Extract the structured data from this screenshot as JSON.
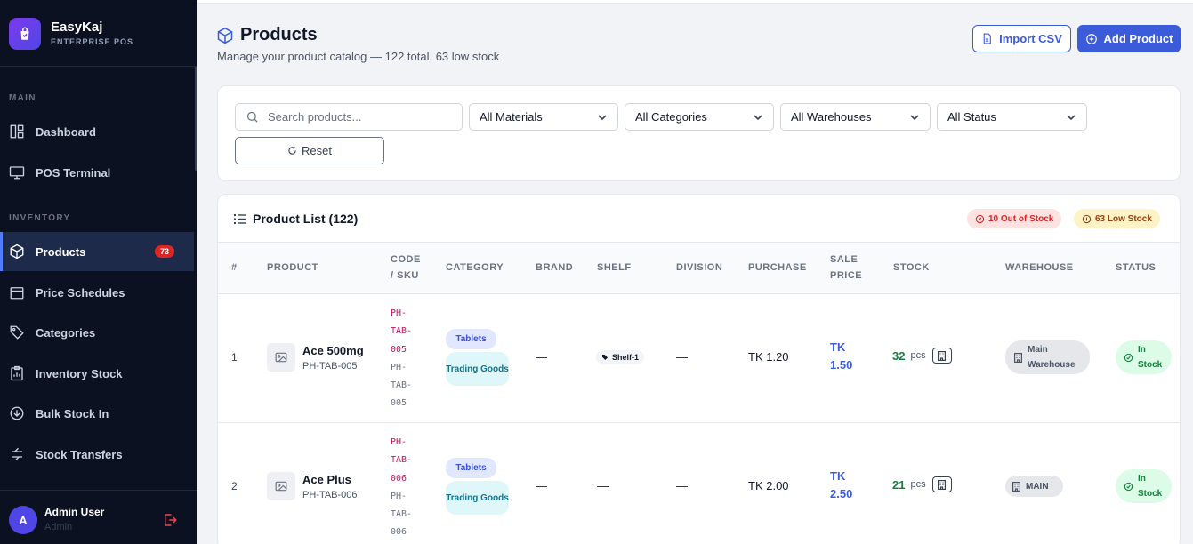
{
  "brand": {
    "name": "EasyKaj",
    "subtitle": "ENTERPRISE POS"
  },
  "sidebar": {
    "sections": [
      {
        "label": "MAIN"
      },
      {
        "label": "INVENTORY"
      }
    ],
    "items": [
      {
        "label": "Dashboard",
        "icon": "dashboard-icon"
      },
      {
        "label": "POS Terminal",
        "icon": "monitor-icon"
      },
      {
        "label": "Products",
        "icon": "box-icon",
        "badge": "73",
        "active": true
      },
      {
        "label": "Price Schedules",
        "icon": "calendar-icon"
      },
      {
        "label": "Categories",
        "icon": "tag-icon"
      },
      {
        "label": "Inventory Stock",
        "icon": "clipboard-icon"
      },
      {
        "label": "Bulk Stock In",
        "icon": "download-circle-icon"
      },
      {
        "label": "Stock Transfers",
        "icon": "transfer-icon"
      }
    ]
  },
  "user": {
    "initial": "A",
    "name": "Admin User",
    "role": "Admin"
  },
  "page": {
    "title": "Products",
    "subtitle": "Manage your product catalog — 122 total, 63 low stock"
  },
  "actions": {
    "import_label": "Import CSV",
    "add_label": "Add Product"
  },
  "filters": {
    "search_placeholder": "Search products...",
    "materials": "All Materials",
    "categories": "All Categories",
    "warehouses": "All Warehouses",
    "status": "All Status",
    "reset_label": "Reset"
  },
  "list": {
    "title": "Product List (122)",
    "out_of_stock": "10 Out of Stock",
    "low_stock": "63 Low Stock"
  },
  "columns": {
    "num": "#",
    "product": "PRODUCT",
    "code_1": "CODE",
    "code_2": "/ SKU",
    "category": "CATEGORY",
    "brand": "BRAND",
    "shelf": "SHELF",
    "division": "DIVISION",
    "purchase": "PURCHASE",
    "sale_1": "SALE",
    "sale_2": "PRICE",
    "stock": "STOCK",
    "warehouse": "WAREHOUSE",
    "status": "STATUS"
  },
  "rows": [
    {
      "num": "1",
      "name": "Ace 500mg",
      "sku": "PH-TAB-005",
      "code_lines": [
        "PH-",
        "TAB-",
        "005"
      ],
      "sku_lines": [
        "PH-",
        "TAB-",
        "005"
      ],
      "category": "Tablets",
      "type": "Trading Goods",
      "brand": "—",
      "shelf": "Shelf-1",
      "division": "—",
      "purchase": "TK 1.20",
      "sale_cur": "TK",
      "sale_val": "1.50",
      "stock": "32",
      "unit": "pcs",
      "warehouse_1": "Main",
      "warehouse_2": "Warehouse",
      "status_1": "In",
      "status_2": "Stock"
    },
    {
      "num": "2",
      "name": "Ace Plus",
      "sku": "PH-TAB-006",
      "code_lines": [
        "PH-",
        "TAB-",
        "006"
      ],
      "sku_lines": [
        "PH-",
        "TAB-",
        "006"
      ],
      "category": "Tablets",
      "type": "Trading Goods",
      "brand": "—",
      "shelf": "—",
      "division": "—",
      "purchase": "TK 2.00",
      "sale_cur": "TK",
      "sale_val": "2.50",
      "stock": "21",
      "unit": "pcs",
      "warehouse": "MAIN",
      "status_1": "In",
      "status_2": "Stock"
    }
  ],
  "colors": {
    "accent": "#3b5bdb",
    "sidebar_bg": "#0b1120",
    "badge": "#dc2626",
    "stock_green": "#15803d"
  }
}
